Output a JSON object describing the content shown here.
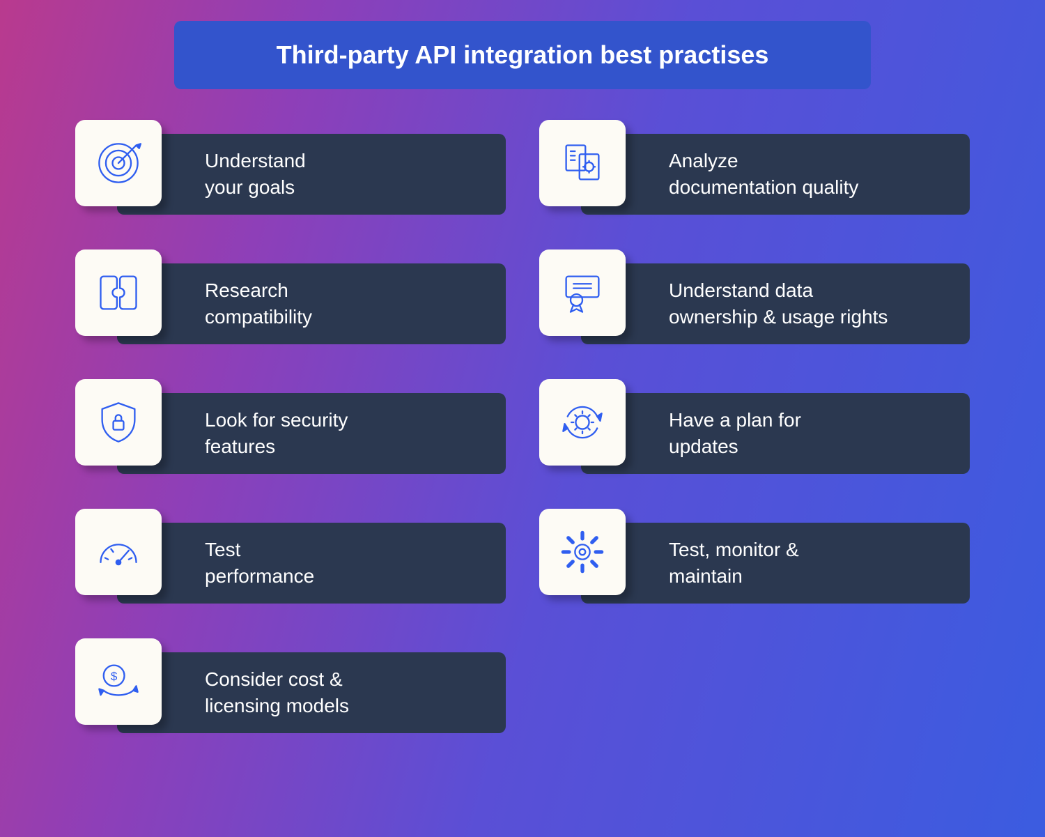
{
  "title": "Third-party API integration best practises",
  "left_items": [
    {
      "label": "Understand\nyour goals",
      "icon": "target-icon"
    },
    {
      "label": "Research\ncompatibility",
      "icon": "puzzle-icon"
    },
    {
      "label": "Look for security\nfeatures",
      "icon": "shield-lock-icon"
    },
    {
      "label": "Test\nperformance",
      "icon": "gauge-icon"
    },
    {
      "label": "Consider cost &\nlicensing models",
      "icon": "cost-cycle-icon"
    }
  ],
  "right_items": [
    {
      "label": "Analyze\ndocumentation quality",
      "icon": "documents-icon"
    },
    {
      "label": "Understand data\nownership & usage rights",
      "icon": "certificate-icon"
    },
    {
      "label": "Have a plan for\nupdates",
      "icon": "gear-cycle-icon"
    },
    {
      "label": "Test, monitor &\nmaintain",
      "icon": "gear-icon"
    }
  ]
}
